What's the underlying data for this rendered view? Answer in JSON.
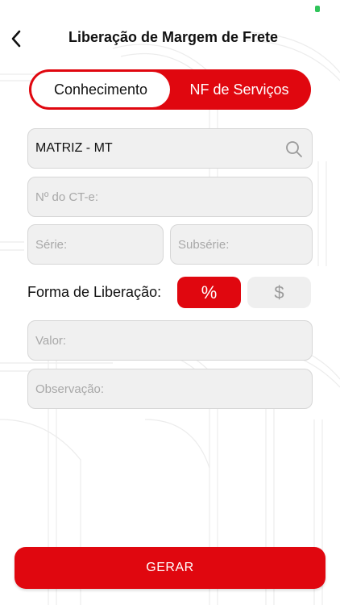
{
  "header": {
    "title": "Liberação de Margem de Frete",
    "back_icon": "chevron-left-icon"
  },
  "segmented_control": {
    "options": [
      "Conhecimento",
      "NF de Serviços"
    ],
    "selected": "Conhecimento"
  },
  "form": {
    "filial": {
      "value": "MATRIZ - MT",
      "icon": "search-icon"
    },
    "cte_number": {
      "placeholder": "Nº do CT-e:"
    },
    "serie": {
      "placeholder": "Série:"
    },
    "subserie": {
      "placeholder": "Subsérie:"
    },
    "forma_liberacao": {
      "label": "Forma de Liberação:",
      "options": [
        "%",
        "$"
      ],
      "selected": "%"
    },
    "valor": {
      "placeholder": "Valor:"
    },
    "observacao": {
      "placeholder": "Observação:"
    }
  },
  "actions": {
    "submit_label": "GERAR"
  },
  "colors": {
    "accent": "#e0070f",
    "field_bg": "#f0f0f0",
    "field_border": "#d6d6d6",
    "placeholder": "#a8a8a8",
    "status_indicator": "#2fc45a"
  }
}
